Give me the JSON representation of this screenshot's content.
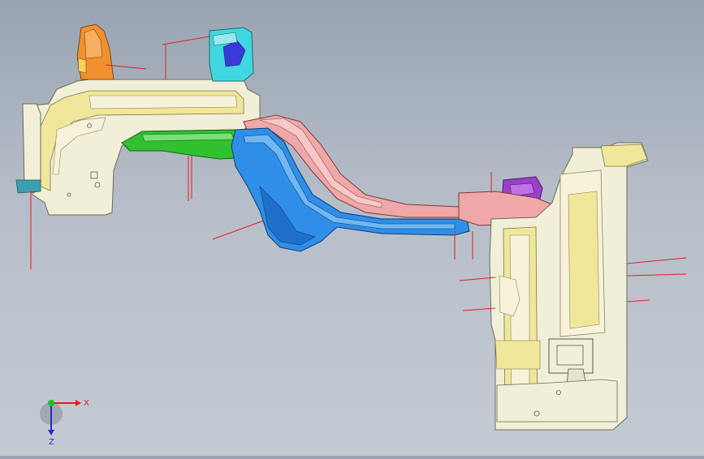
{
  "triad": {
    "x_label": "X",
    "z_label": "Z",
    "x_color": "#e02020",
    "z_color": "#2a2ad0",
    "y_color": "#20c020"
  },
  "colors": {
    "background_top": "#9aa4b2",
    "background_bottom": "#c4cbd4",
    "part_white": "#f2efd8",
    "part_yellow": "#f0e79a",
    "part_blue": "#2f8fe8",
    "part_green": "#30c030",
    "part_pink": "#f0a7a7",
    "part_orange": "#f09030",
    "part_cyan": "#40d8e0",
    "part_purple": "#9a40c8",
    "leader_lines": "#e02020"
  }
}
